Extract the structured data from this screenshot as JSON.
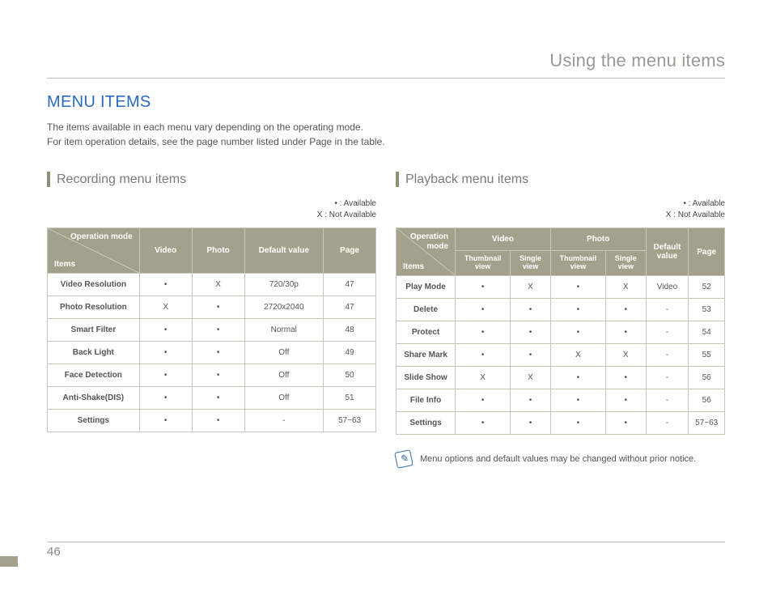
{
  "header": {
    "title": "Using the menu items"
  },
  "mainTitle": "MENU ITEMS",
  "intro": {
    "line1": "The items available in each menu vary depending on the operating mode.",
    "line2": "For item operation details, see the page number listed under Page in the table."
  },
  "legend": {
    "available": "• : Available",
    "notAvailable": "X : Not Available"
  },
  "diagLabels": {
    "top": "Operation mode",
    "bottom": "Items"
  },
  "recording": {
    "title": "Recording menu items",
    "headers": {
      "video": "Video",
      "photo": "Photo",
      "default": "Default value",
      "page": "Page"
    },
    "rows": [
      {
        "item": "Video Resolution",
        "video": "•",
        "photo": "X",
        "default": "720/30p",
        "page": "47"
      },
      {
        "item": "Photo Resolution",
        "video": "X",
        "photo": "•",
        "default": "2720x2040",
        "page": "47"
      },
      {
        "item": "Smart Filter",
        "video": "•",
        "photo": "•",
        "default": "Normal",
        "page": "48"
      },
      {
        "item": "Back Light",
        "video": "•",
        "photo": "•",
        "default": "Off",
        "page": "49"
      },
      {
        "item": "Face Detection",
        "video": "•",
        "photo": "•",
        "default": "Off",
        "page": "50"
      },
      {
        "item": "Anti-Shake(DIS)",
        "video": "•",
        "photo": "•",
        "default": "Off",
        "page": "51"
      },
      {
        "item": "Settings",
        "video": "•",
        "photo": "•",
        "default": "-",
        "page": "57~63"
      }
    ]
  },
  "playback": {
    "title": "Playback menu items",
    "headers": {
      "video": "Video",
      "photo": "Photo",
      "thumb": "Thumbnail view",
      "single": "Single view",
      "default": "Default value",
      "page": "Page"
    },
    "rows": [
      {
        "item": "Play Mode",
        "vt": "•",
        "vs": "X",
        "pt": "•",
        "ps": "X",
        "default": "Video",
        "page": "52"
      },
      {
        "item": "Delete",
        "vt": "•",
        "vs": "•",
        "pt": "•",
        "ps": "•",
        "default": "-",
        "page": "53"
      },
      {
        "item": "Protect",
        "vt": "•",
        "vs": "•",
        "pt": "•",
        "ps": "•",
        "default": "-",
        "page": "54"
      },
      {
        "item": "Share Mark",
        "vt": "•",
        "vs": "•",
        "pt": "X",
        "ps": "X",
        "default": "-",
        "page": "55"
      },
      {
        "item": "Slide Show",
        "vt": "X",
        "vs": "X",
        "pt": "•",
        "ps": "•",
        "default": "-",
        "page": "56"
      },
      {
        "item": "File Info",
        "vt": "•",
        "vs": "•",
        "pt": "•",
        "ps": "•",
        "default": "-",
        "page": "56"
      },
      {
        "item": "Settings",
        "vt": "•",
        "vs": "•",
        "pt": "•",
        "ps": "•",
        "default": "-",
        "page": "57~63"
      }
    ]
  },
  "note": "Menu options and default values may be changed without prior notice.",
  "pageNumber": "46"
}
